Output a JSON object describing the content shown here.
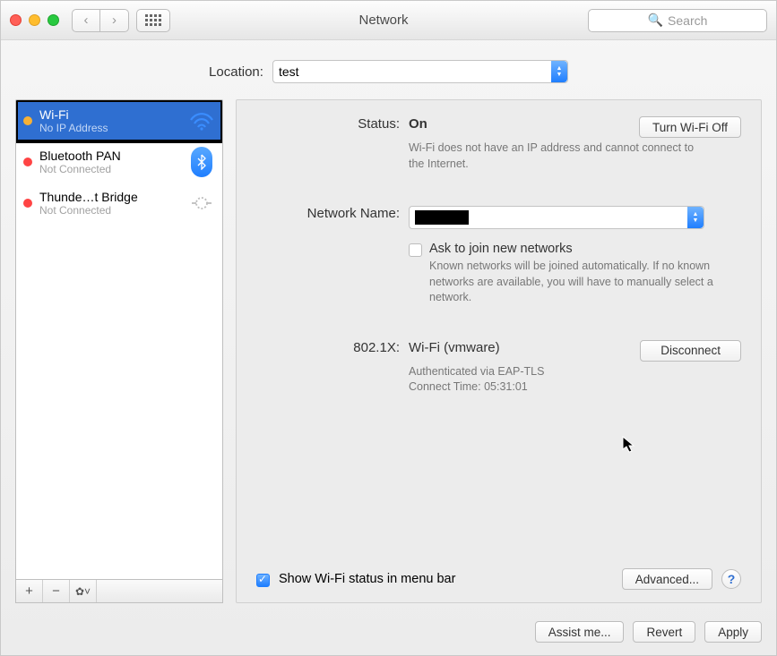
{
  "window_title": "Network",
  "search_placeholder": "Search",
  "location_label": "Location:",
  "location_value": "test",
  "sidebar": {
    "items": [
      {
        "name": "Wi-Fi",
        "status": "No IP Address",
        "status_color": "orange",
        "icon": "wifi"
      },
      {
        "name": "Bluetooth PAN",
        "status": "Not Connected",
        "status_color": "red",
        "icon": "bluetooth"
      },
      {
        "name": "Thunde…t Bridge",
        "status": "Not Connected",
        "status_color": "red",
        "icon": "thunderbolt"
      }
    ]
  },
  "main": {
    "status_label": "Status:",
    "status_value": "On",
    "wifi_toggle_label": "Turn Wi-Fi Off",
    "status_sub": "Wi-Fi does not have an IP address and cannot connect to the Internet.",
    "network_name_label": "Network Name:",
    "ask_join_label": "Ask to join new networks",
    "ask_join_sub": "Known networks will be joined automatically. If no known networks are available, you will have to manually select a network.",
    "dot1x_label": "802.1X:",
    "dot1x_value": "Wi-Fi (vmware)",
    "disconnect_label": "Disconnect",
    "dot1x_sub1": "Authenticated via EAP-TLS",
    "dot1x_sub2": "Connect Time: 05:31:01",
    "show_status_label": "Show Wi-Fi status in menu bar",
    "advanced_label": "Advanced..."
  },
  "footer": {
    "assist": "Assist me...",
    "revert": "Revert",
    "apply": "Apply"
  }
}
